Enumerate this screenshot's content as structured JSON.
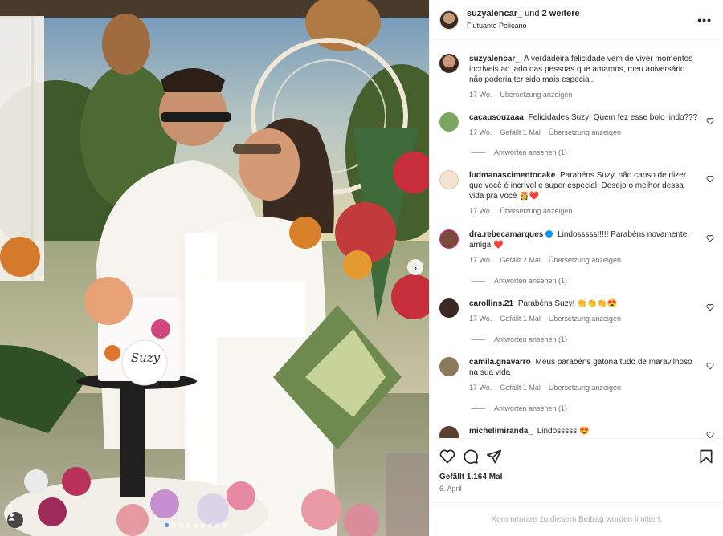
{
  "post": {
    "author": "suzyalencar_",
    "and_text": "und",
    "others": "2 weitere",
    "location": "Flutuante Pelicano"
  },
  "caption": {
    "user": "suzyalencar_",
    "text": "A verdadeira felicidade vem de viver momentos incríveis ao lado das pessoas que amamos, meu aniversário não poderia ter sido mais especial.",
    "time": "17 Wo.",
    "translate": "Übersetzung anzeigen"
  },
  "photo": {
    "cake_name": "Suzy"
  },
  "comments": [
    {
      "user": "cacausouzaaa",
      "text": "Felicidades Suzy! Quem fez esse bolo lindo???",
      "time": "17 Wo.",
      "likes": "Gefällt 1 Mal",
      "translate": "Übersetzung anzeigen",
      "replies": "Antworten ansehen (1)",
      "avatar_color": "#7aa860"
    },
    {
      "user": "ludmanascimentocake",
      "text": "Parabéns Suzy, não canso de dizer que você é incrível e super especial! Desejo o melhor dessa vida pra você",
      "emoji": "👸❤️",
      "time": "17 Wo.",
      "translate": "Übersetzung anzeigen",
      "avatar_color": "#f3e4d0"
    },
    {
      "user": "dra.rebecamarques",
      "text": "Lindosssss!!!!! Parabéns novamente, amiga",
      "emoji": "❤️",
      "time": "17 Wo.",
      "likes": "Gefällt 2 Mal",
      "translate": "Übersetzung anzeigen",
      "replies": "Antworten ansehen (1)",
      "avatar_color": "#7a4b3a"
    },
    {
      "user": "carollins.21",
      "text": "Parabéns Suzy!",
      "emoji": "👏👏👏😍",
      "time": "17 Wo.",
      "likes": "Gefällt 1 Mal",
      "translate": "Übersetzung anzeigen",
      "replies": "Antworten ansehen (1)",
      "avatar_color": "#3a2a22"
    },
    {
      "user": "camila.gnavarro",
      "text": "Meus parabéns gatona tudo de maravilhoso na sua vida",
      "time": "17 Wo.",
      "likes": "Gefällt 1 Mal",
      "translate": "Übersetzung anzeigen",
      "replies": "Antworten ansehen (1)",
      "avatar_color": "#8a7a5a"
    },
    {
      "user": "michelimiranda_",
      "text": "Lindosssss",
      "emoji": "😍",
      "avatar_color": "#5a4030"
    }
  ],
  "footer": {
    "likes": "Gefällt 1.164 Mal",
    "date": "6. April",
    "limited": "Kommentare zu diesem Beitrag wurden limitiert."
  },
  "colors": {
    "accent": "#0095f6",
    "heart_red": "#ed4956",
    "muted": "#737373"
  },
  "icons": [
    "heart-icon",
    "comment-icon",
    "share-icon",
    "bookmark-icon",
    "more-icon",
    "chevron-right-icon",
    "user-tag-icon",
    "verified-badge-icon"
  ]
}
